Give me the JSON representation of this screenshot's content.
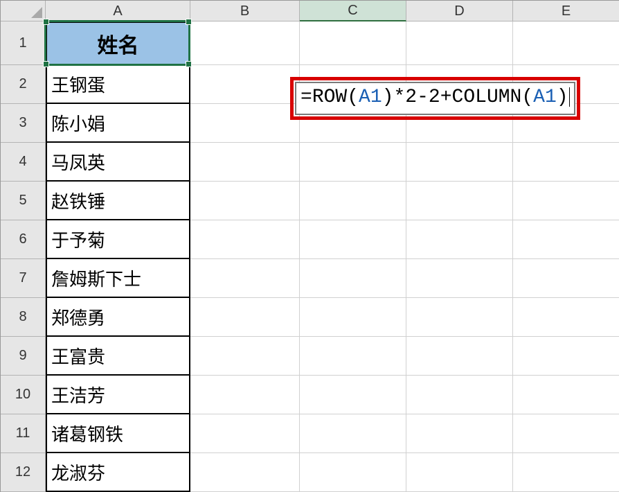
{
  "columns": [
    "A",
    "B",
    "C",
    "D",
    "E"
  ],
  "rows": [
    "1",
    "2",
    "3",
    "4",
    "5",
    "6",
    "7",
    "8",
    "9",
    "10",
    "11",
    "12"
  ],
  "active_column": "C",
  "header_label": "姓名",
  "data_column_a": [
    "王钢蛋",
    "陈小娟",
    "马凤英",
    "赵铁锤",
    "于予菊",
    "詹姆斯下士",
    "郑德勇",
    "王富贵",
    "王洁芳",
    "诸葛钢铁",
    "龙淑芬"
  ],
  "formula": {
    "eq": "=",
    "fn1": "ROW",
    "open1": "(",
    "ref1": "A1",
    "close1": ")",
    "op1": "*",
    "num1": "2",
    "op2": "-",
    "num2": "2",
    "op3": "+",
    "fn2": "COLUMN",
    "open2": "(",
    "ref2": "A1",
    "close2": ")"
  },
  "formula_plain": "=ROW(A1)*2-2+COLUMN(A1)"
}
